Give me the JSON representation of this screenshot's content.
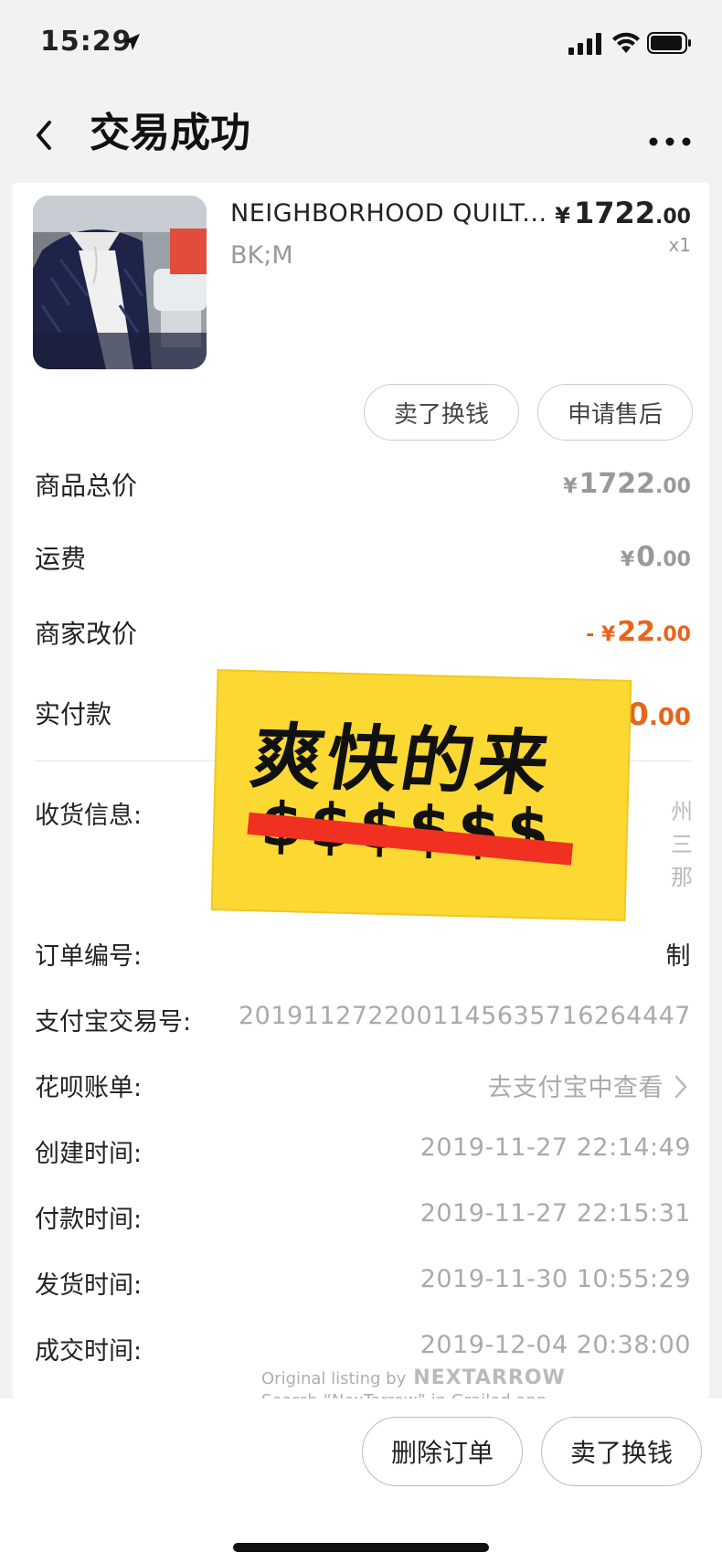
{
  "status_bar": {
    "time": "15:29",
    "icons": [
      "location-arrow-icon",
      "signal-icon",
      "wifi-icon",
      "battery-icon"
    ]
  },
  "nav": {
    "title": "交易成功",
    "back_icon": "chevron-left-icon",
    "more_icon": "more-horizontal-icon"
  },
  "product": {
    "name": "NEIGHBORHOOD QUILT...",
    "sku": "BK;M",
    "price_currency": "¥",
    "price_int": "1722",
    "price_dec": ".00",
    "quantity": "x1"
  },
  "actions": {
    "sell_label": "卖了换钱",
    "aftersale_label": "申请售后"
  },
  "prices": {
    "total_label": "商品总价",
    "total_cur": "¥",
    "total_int": "1722",
    "total_dec": ".00",
    "shipping_label": "运费",
    "shipping_cur": "¥",
    "shipping_int": "0",
    "shipping_dec": ".00",
    "discount_label": "商家改价",
    "discount_cur": "- ¥",
    "discount_int": "22",
    "discount_dec": ".00",
    "paid_label": "实付款",
    "paid_cur": "¥",
    "paid_int": "1700",
    "paid_dec": ".00"
  },
  "info": {
    "address_label": "收货信息:",
    "address_fragments": [
      "州",
      "三",
      "那"
    ],
    "order_no_label": "订单编号:",
    "order_no_fragment": "制",
    "alipay_label": "支付宝交易号:",
    "alipay_value": "2019112722001145635716264447",
    "huabei_label": "花呗账单:",
    "huabei_value": "去支付宝中查看",
    "created_label": "创建时间:",
    "created_value": "2019-11-27 22:14:49",
    "paytime_label": "付款时间:",
    "paytime_value": "2019-11-27 22:15:31",
    "shiptime_label": "发货时间:",
    "shiptime_value": "2019-11-30 10:55:29",
    "dealtime_label": "成交时间:",
    "dealtime_value": "2019-12-04 20:38:00"
  },
  "sticker": {
    "title": "爽快的来",
    "dollars": "$$$$$$",
    "bg_color": "#fcd833",
    "strike_color": "#f03020"
  },
  "watermark": {
    "line1": "Original listing by",
    "brand": "NEXTARROW",
    "line2": "Search “NexTarrow” in Grailed app."
  },
  "bottom": {
    "delete_label": "删除订单",
    "sell_label": "卖了换钱"
  },
  "colors": {
    "accent_orange": "#e8641b",
    "muted_text": "#999999"
  }
}
